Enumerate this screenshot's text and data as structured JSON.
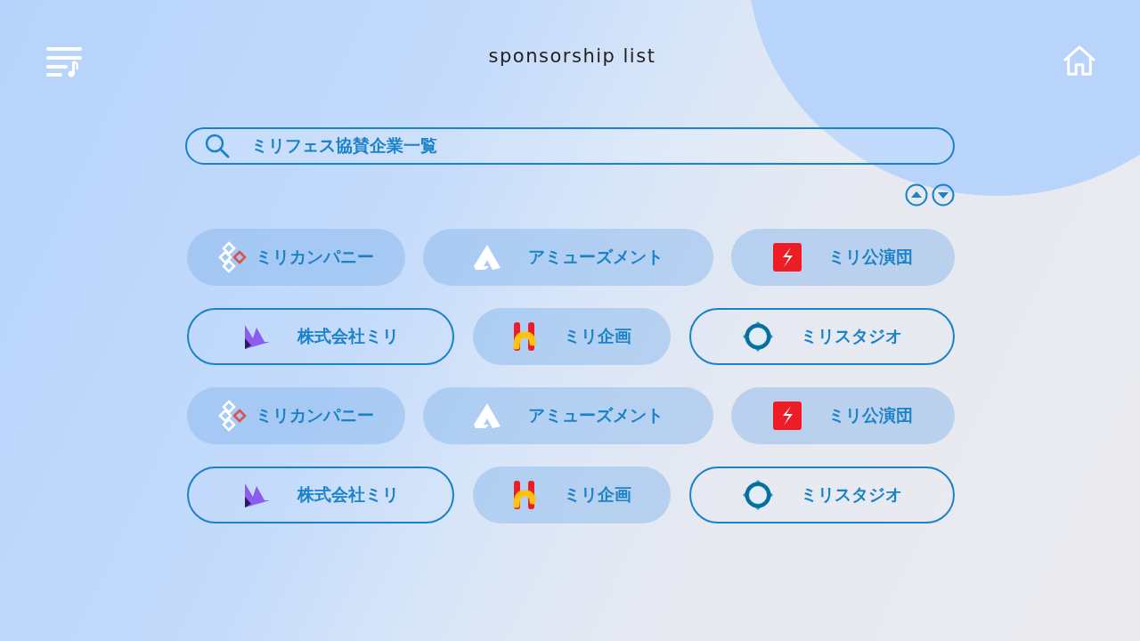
{
  "header": {
    "title": "sponsorship list"
  },
  "search": {
    "value": "ミリフェス協賛企業一覧"
  },
  "rows": [
    [
      {
        "label": "ミリカンパニー",
        "outlined": false,
        "kind": "diamonds"
      },
      {
        "label": "アミューズメント",
        "outlined": false,
        "kind": "peak"
      },
      {
        "label": "ミリ公演団",
        "outlined": false,
        "kind": "bolt"
      }
    ],
    [
      {
        "label": "株式会社ミリ",
        "outlined": true,
        "kind": "wave"
      },
      {
        "label": "ミリ企画",
        "outlined": false,
        "kind": "h"
      },
      {
        "label": "ミリスタジオ",
        "outlined": true,
        "kind": "ring"
      }
    ],
    [
      {
        "label": "ミリカンパニー",
        "outlined": false,
        "kind": "diamonds"
      },
      {
        "label": "アミューズメント",
        "outlined": false,
        "kind": "peak"
      },
      {
        "label": "ミリ公演団",
        "outlined": false,
        "kind": "bolt"
      }
    ],
    [
      {
        "label": "株式会社ミリ",
        "outlined": true,
        "kind": "wave"
      },
      {
        "label": "ミリ企画",
        "outlined": false,
        "kind": "h"
      },
      {
        "label": "ミリスタジオ",
        "outlined": true,
        "kind": "ring"
      }
    ]
  ]
}
